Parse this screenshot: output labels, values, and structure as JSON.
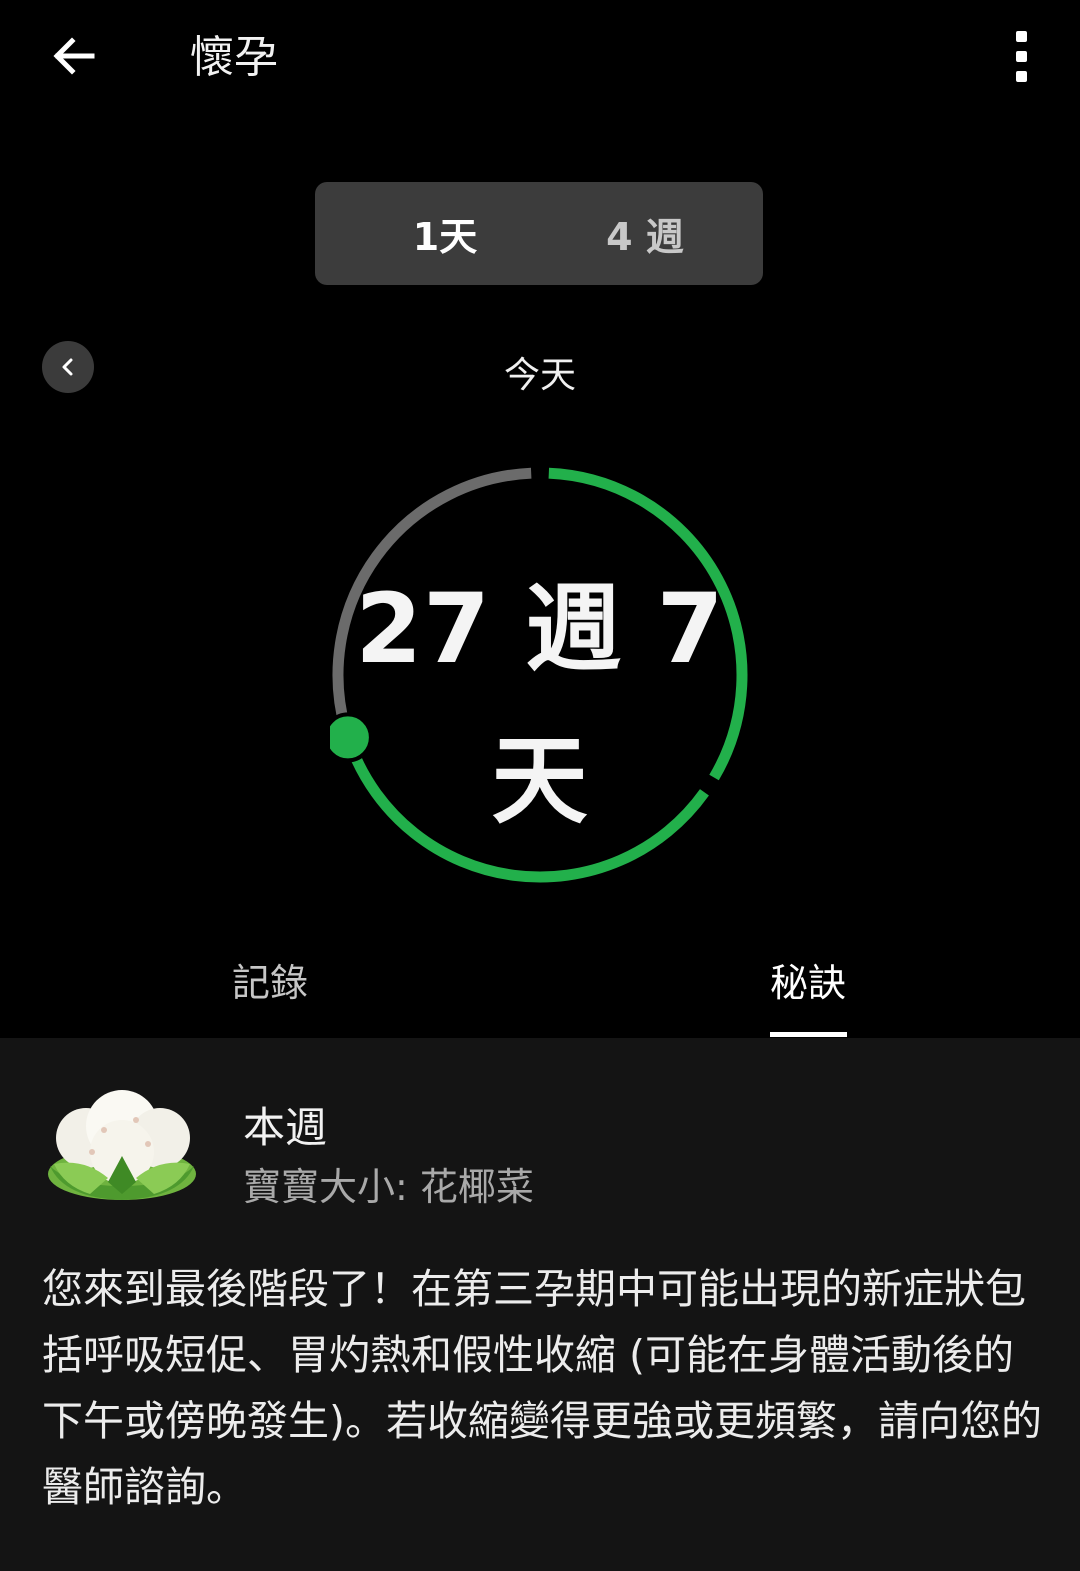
{
  "appbar": {
    "title": "懷孕"
  },
  "segment": {
    "options": [
      "1天",
      "4 週"
    ],
    "selected": "1天"
  },
  "date": {
    "label": "今天"
  },
  "progress": {
    "line1": "27 週 7",
    "line2": "天",
    "weeks": 27,
    "days": 7,
    "fraction": 0.7,
    "accent_color": "#22b04b",
    "track_color": "#6b6b6b"
  },
  "tabs": {
    "records": "記錄",
    "tips": "秘訣",
    "selected": "秘訣"
  },
  "tip": {
    "heading": "本週",
    "baby_size": "寶寶大小: 花椰菜",
    "body": "您來到最後階段了！在第三孕期中可能出現的新症狀包括呼吸短促、胃灼熱和假性收縮 (可能在身體活動後的下午或傍晚發生)。若收縮變得更強或更頻繁，請向您的醫師諮詢。"
  },
  "icons": {
    "back": "arrow-back-icon",
    "more": "more-vert-icon",
    "prev": "chevron-left-icon",
    "baby": "cauliflower-icon"
  }
}
